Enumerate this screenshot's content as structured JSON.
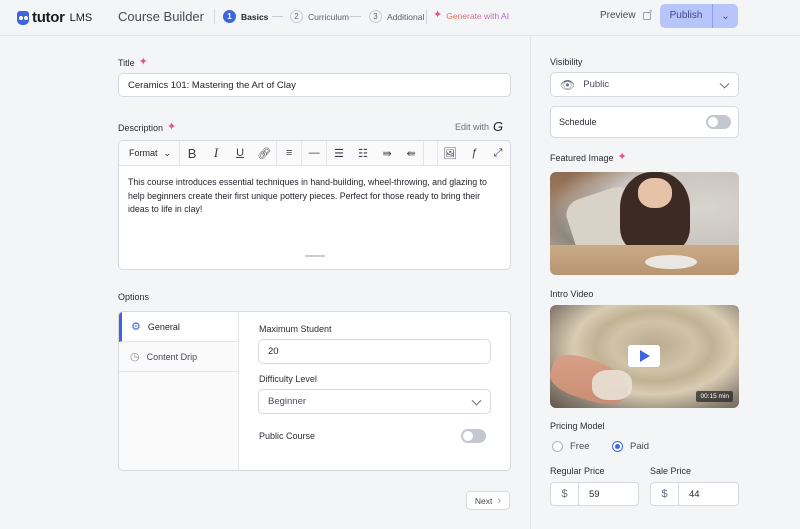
{
  "header": {
    "logo_text": "tutor",
    "logo_suffix": "LMS",
    "title": "Course Builder",
    "steps": [
      {
        "num": "1",
        "label": "Basics",
        "active": true
      },
      {
        "num": "2",
        "label": "Curriculum",
        "active": false
      },
      {
        "num": "3",
        "label": "Additional",
        "active": false
      }
    ],
    "generate_ai": "Generate with AI",
    "preview": "Preview",
    "publish": "Publish"
  },
  "main": {
    "title_label": "Title",
    "title_value": "Ceramics 101: Mastering the Art of Clay",
    "description_label": "Description",
    "edit_with": "Edit with",
    "toolbar": {
      "format": "Format",
      "buttons": [
        "bold",
        "italic",
        "underline",
        "link",
        "align",
        "horizontal-rule",
        "bullet-list",
        "numbered-list",
        "indent",
        "outdent",
        "image",
        "formula",
        "fullscreen"
      ]
    },
    "description_text": "This course introduces essential techniques in hand-building, wheel-throwing, and glazing to help beginners create their first unique pottery pieces. Perfect for those ready to bring their ideas to life in clay!",
    "options_label": "Options",
    "option_tabs": [
      {
        "label": "General",
        "icon": "gear-icon",
        "active": true
      },
      {
        "label": "Content Drip",
        "icon": "clock-icon",
        "active": false
      }
    ],
    "max_student_label": "Maximum Student",
    "max_student_value": "20",
    "difficulty_label": "Difficulty Level",
    "difficulty_value": "Beginner",
    "public_course_label": "Public Course",
    "public_course_on": false,
    "next": "Next"
  },
  "sidebar": {
    "visibility_label": "Visibility",
    "visibility_value": "Public",
    "schedule_label": "Schedule",
    "schedule_on": false,
    "featured_image_label": "Featured Image",
    "intro_video_label": "Intro Video",
    "video_duration": "00:15 min",
    "pricing_label": "Pricing Model",
    "pricing_options": [
      {
        "label": "Free",
        "selected": false
      },
      {
        "label": "Paid",
        "selected": true
      }
    ],
    "regular_price_label": "Regular Price",
    "regular_price_currency": "$",
    "regular_price_value": "59",
    "sale_price_label": "Sale Price",
    "sale_price_currency": "$",
    "sale_price_value": "44"
  },
  "colors": {
    "accent": "#3e64de",
    "publish_bg": "#b8c5fb",
    "background": "#f4f5f7"
  }
}
